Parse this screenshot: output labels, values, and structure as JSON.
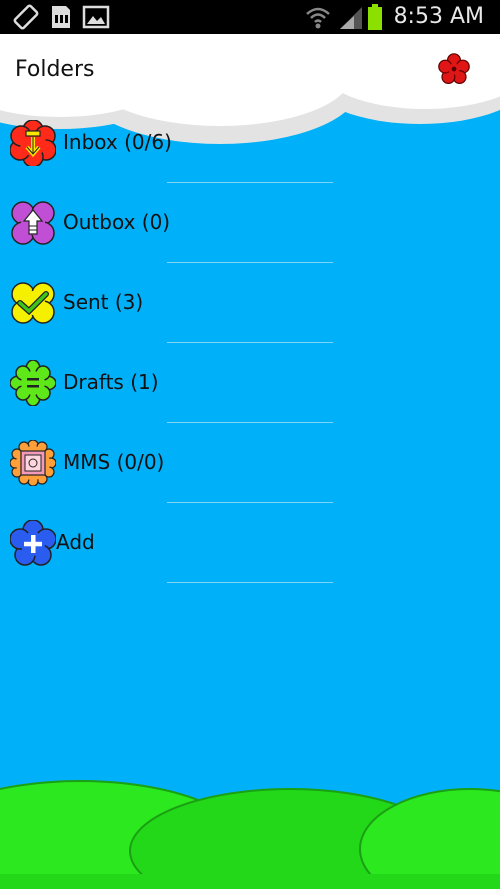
{
  "status_bar": {
    "time": "8:53 AM",
    "icons": [
      "rotation-lock-icon",
      "sd-card-icon",
      "image-icon",
      "wifi-icon",
      "signal-icon",
      "battery-icon"
    ]
  },
  "header": {
    "title": "Folders",
    "settings_icon": "red-flower-icon"
  },
  "folders": [
    {
      "label": "Inbox (0/6)",
      "icon": "inbox-flower-icon",
      "color": "#ff2a1a"
    },
    {
      "label": "Outbox (0)",
      "icon": "outbox-flower-icon",
      "color": "#c04fd6"
    },
    {
      "label": "Sent (3)",
      "icon": "sent-flower-icon",
      "color": "#f5f000"
    },
    {
      "label": "Drafts (1)",
      "icon": "drafts-flower-icon",
      "color": "#5ee81a"
    },
    {
      "label": "MMS (0/0)",
      "icon": "mms-flower-icon",
      "color": "#ff9f3a"
    },
    {
      "label": "Add",
      "icon": "add-flower-icon",
      "color": "#2a5cf0"
    }
  ],
  "colors": {
    "sky": "#00b0f8",
    "hill": "#22d818",
    "cloud": "#ffffff"
  }
}
